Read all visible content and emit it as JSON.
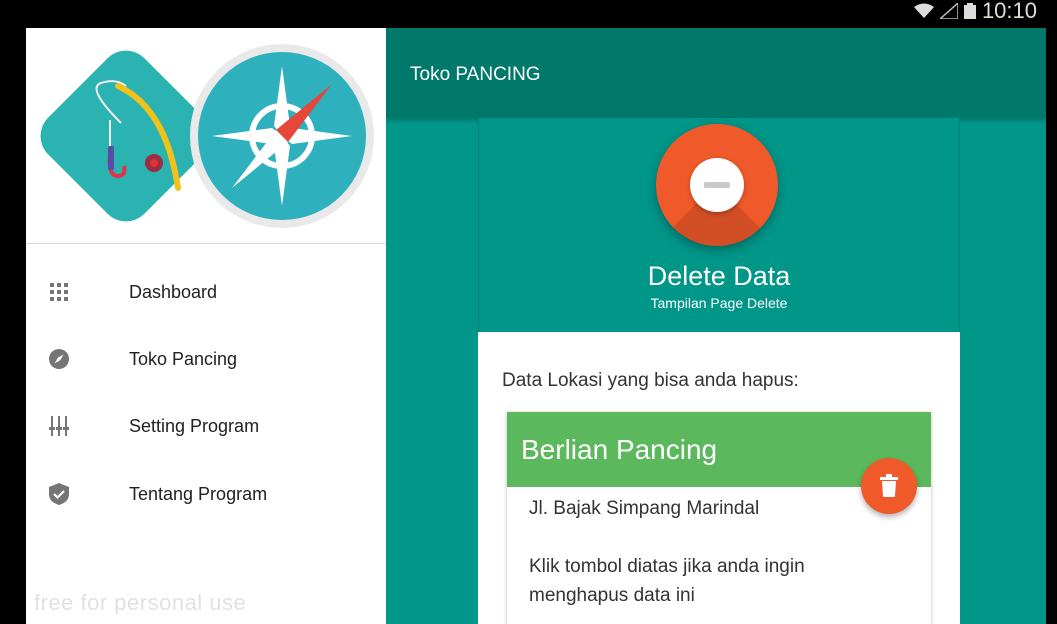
{
  "status_bar": {
    "time": "10:10",
    "icons": [
      "wifi-icon",
      "signal-icon",
      "battery-icon"
    ]
  },
  "drawer": {
    "header_logo": "fishing-compass-logo",
    "items": [
      {
        "label": "Dashboard",
        "icon": "grid-icon"
      },
      {
        "label": "Toko Pancing",
        "icon": "compass-icon"
      },
      {
        "label": "Setting Program",
        "icon": "equalizer-icon"
      },
      {
        "label": "Tentang Program",
        "icon": "shield-check-icon"
      }
    ],
    "watermark": "free for personal use"
  },
  "toolbar": {
    "title": "Toko PANCING"
  },
  "page": {
    "title": "Delete Data",
    "subtitle": "Tampilan Page Delete",
    "prompt": "Data Lokasi yang bisa anda hapus:"
  },
  "item": {
    "name": "Berlian Pancing",
    "address": "Jl. Bajak Simpang Marindal",
    "note": "Klik tombol diatas jika anda ingin menghapus data ini"
  },
  "colors": {
    "toolbar": "#00796b",
    "primary": "#009688",
    "accent": "#f0592a",
    "item_header": "#5cb85c"
  }
}
